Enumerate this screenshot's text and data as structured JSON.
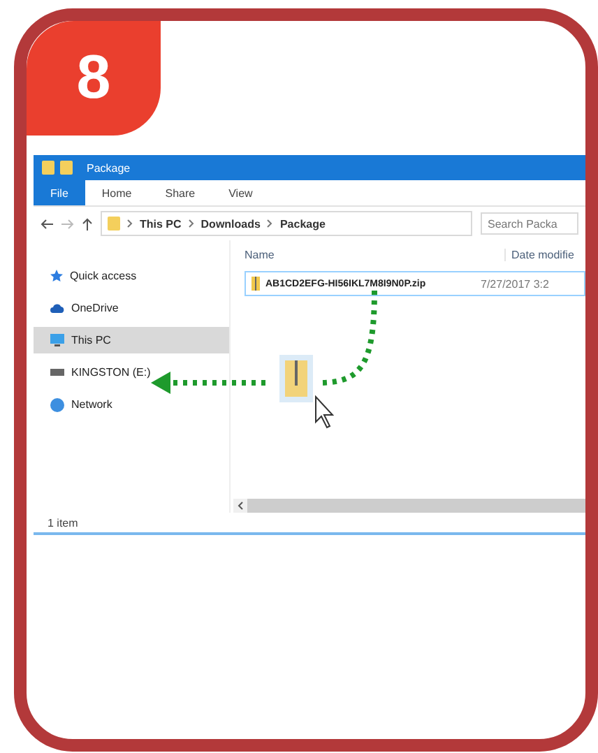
{
  "step_badge": "8",
  "window": {
    "title": "Package"
  },
  "ribbon_tabs": [
    {
      "label": "File",
      "selected": true
    },
    {
      "label": "Home",
      "selected": false
    },
    {
      "label": "Share",
      "selected": false
    },
    {
      "label": "View",
      "selected": false
    }
  ],
  "address_bar": {
    "path": [
      "This PC",
      "Downloads",
      "Package"
    ]
  },
  "search": {
    "placeholder": "Search Packa"
  },
  "sidebar": {
    "items": [
      {
        "label": "Quick access",
        "kind": "star",
        "selected": false
      },
      {
        "label": "OneDrive",
        "kind": "cloud",
        "selected": false
      },
      {
        "label": "This PC",
        "kind": "pc",
        "selected": true
      },
      {
        "label": "KINGSTON (E:)",
        "kind": "drive",
        "selected": false
      },
      {
        "label": "Network",
        "kind": "network",
        "selected": false
      }
    ]
  },
  "table": {
    "columns": [
      "Name",
      "Date modifie"
    ],
    "rows": [
      {
        "name": "AB1CD2EFG-HI56IKL7M8I9N0P.zip",
        "date": "7/27/2017 3:2",
        "selected": true
      }
    ]
  },
  "status_bar": "1 item"
}
